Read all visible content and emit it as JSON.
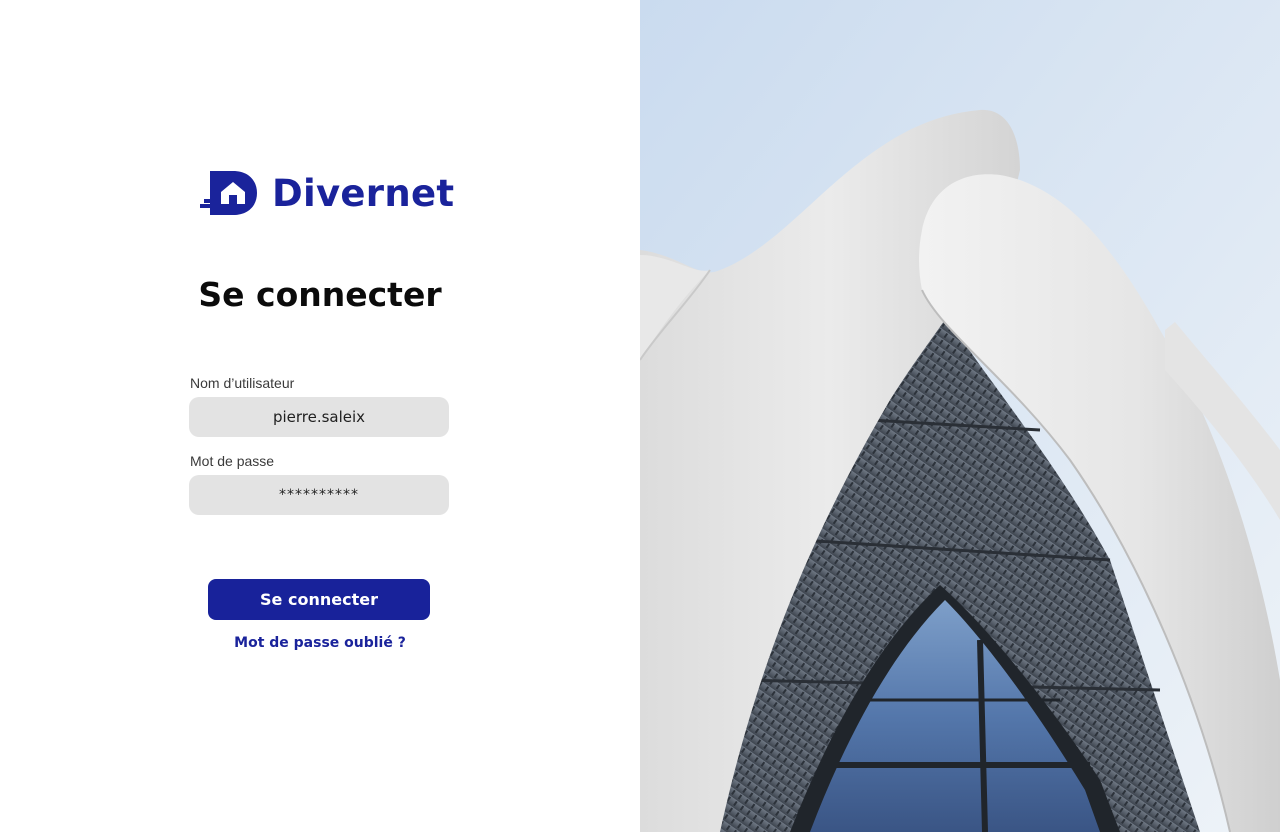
{
  "brand": {
    "name": "Divernet",
    "logo_icon": "house-d-logo-icon",
    "color": "#1a239b"
  },
  "login": {
    "title": "Se connecter",
    "username_label": "Nom d’utilisateur",
    "username_value": "pierre.saleix",
    "password_label": "Mot de passe",
    "password_value": "**********",
    "submit_label": "Se connecter",
    "forgot_label": "Mot de passe oublié ?"
  },
  "colors": {
    "primary": "#18229a",
    "field_background": "#e3e3e3"
  }
}
